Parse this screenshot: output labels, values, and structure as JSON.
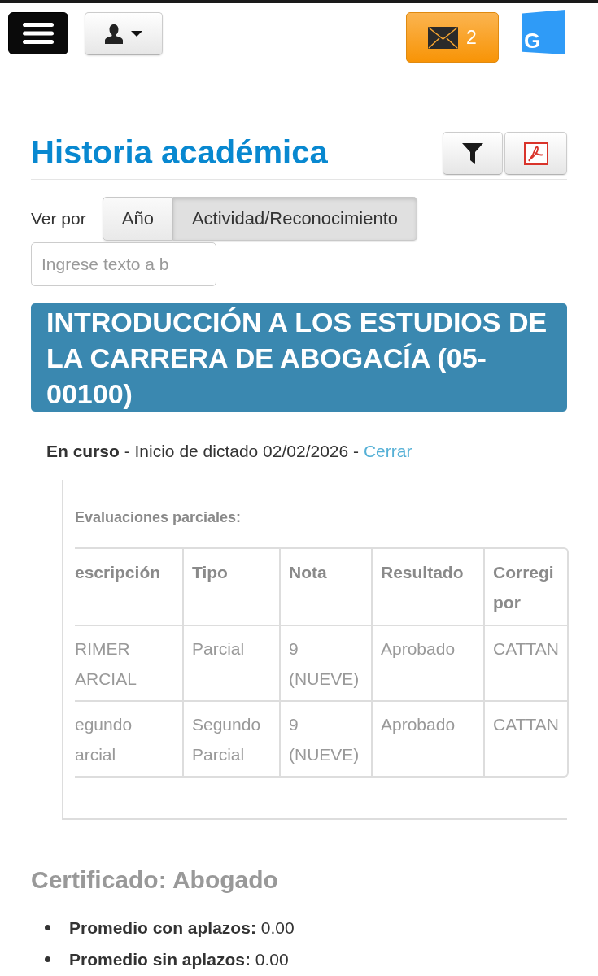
{
  "header": {
    "mail_count": "2",
    "logo_text": "G"
  },
  "page": {
    "title": "Historia académica"
  },
  "view_by": {
    "label": "Ver por",
    "options": [
      {
        "label": "Año",
        "selected": false
      },
      {
        "label": "Actividad/Reconocimiento",
        "selected": true
      }
    ]
  },
  "search": {
    "placeholder": "Ingrese texto a b"
  },
  "course": {
    "title": "INTRODUCCIÓN A LOS ESTUDIOS DE LA CARRERA DE ABOGACÍA (05-00100)",
    "status": "**En curso** - Inicio de dictado 02/02/2026 -",
    "link": "Cerrar",
    "evaluations": {
      "heading": "Evaluaciones parciales:",
      "columns": [
        "escripción",
        "Tipo",
        "Nota",
        "Resultado",
        "Corregi por"
      ],
      "rows": [
        [
          "RIMER ARCIAL",
          "Parcial",
          "9 (NUEVE)",
          "Aprobado",
          "CATTAN"
        ],
        [
          "egundo arcial",
          "Segundo Parcial",
          "9 (NUEVE)",
          "Aprobado",
          "CATTAN"
        ]
      ]
    }
  },
  "certificate": {
    "title": "Certificado: Abogado",
    "items": [
      "**Promedio con aplazos:** 0.00",
      "**Promedio sin aplazos:** 0.00"
    ]
  }
}
